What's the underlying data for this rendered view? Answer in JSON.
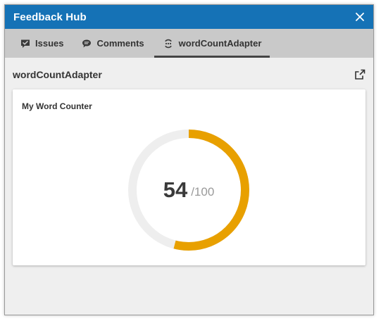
{
  "window": {
    "title": "Feedback Hub"
  },
  "tabs": [
    {
      "label": "Issues",
      "icon": "issues-icon",
      "active": false
    },
    {
      "label": "Comments",
      "icon": "comment-icon",
      "active": false
    },
    {
      "label": "wordCountAdapter",
      "icon": "adapter-icon",
      "active": true
    }
  ],
  "panel": {
    "title": "wordCountAdapter",
    "popout_icon": "external-link-icon"
  },
  "widget": {
    "title": "My Word Counter",
    "value": "54",
    "max": "/100",
    "progress_fraction": 0.54,
    "colors": {
      "accent": "#e8a000",
      "track": "#eeeeee",
      "titlebar": "#1572b6"
    }
  }
}
